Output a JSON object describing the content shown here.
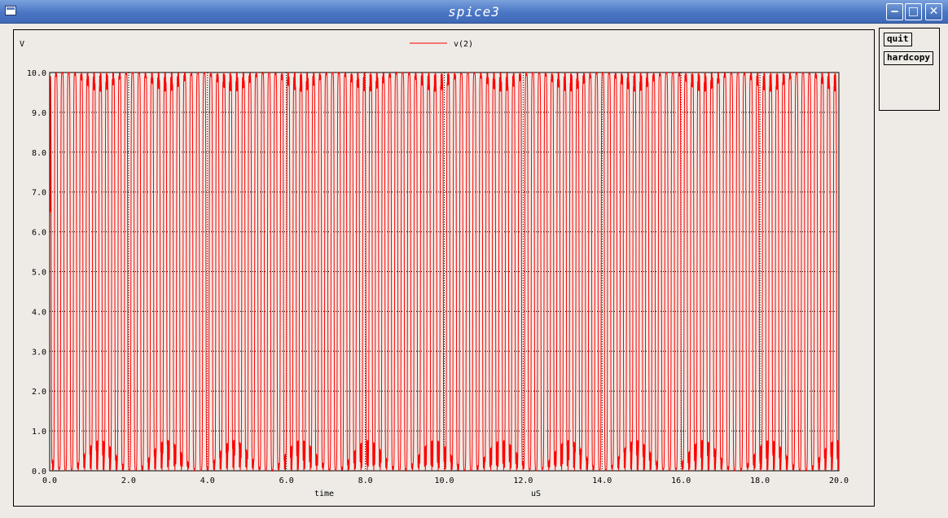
{
  "window": {
    "title": "spice3",
    "min_glyph": "‒",
    "max_glyph": "□",
    "close_glyph": "✕"
  },
  "buttons": {
    "quit": "quit",
    "hardcopy": "hardcopy"
  },
  "chart_data": {
    "type": "line",
    "ylabel": "V",
    "xlabel": "time",
    "xunit": "uS",
    "legend": "v(2)",
    "legend_position": "top-center",
    "grid": true,
    "xlim": [
      0.0,
      20.0
    ],
    "ylim": [
      0.0,
      10.0
    ],
    "xticks": [
      "0.0",
      "2.0",
      "4.0",
      "6.0",
      "8.0",
      "10.0",
      "12.0",
      "14.0",
      "16.0",
      "18.0",
      "20.0"
    ],
    "yticks": [
      "0.0",
      "1.0",
      "2.0",
      "3.0",
      "4.0",
      "5.0",
      "6.0",
      "7.0",
      "8.0",
      "9.0",
      "10.0"
    ],
    "series": [
      {
        "name": "v(2)",
        "color": "#ff0000",
        "period_us": 0.163,
        "v_min": 0.0,
        "v_max": 10.0,
        "initial_value": 6.5
      }
    ]
  }
}
